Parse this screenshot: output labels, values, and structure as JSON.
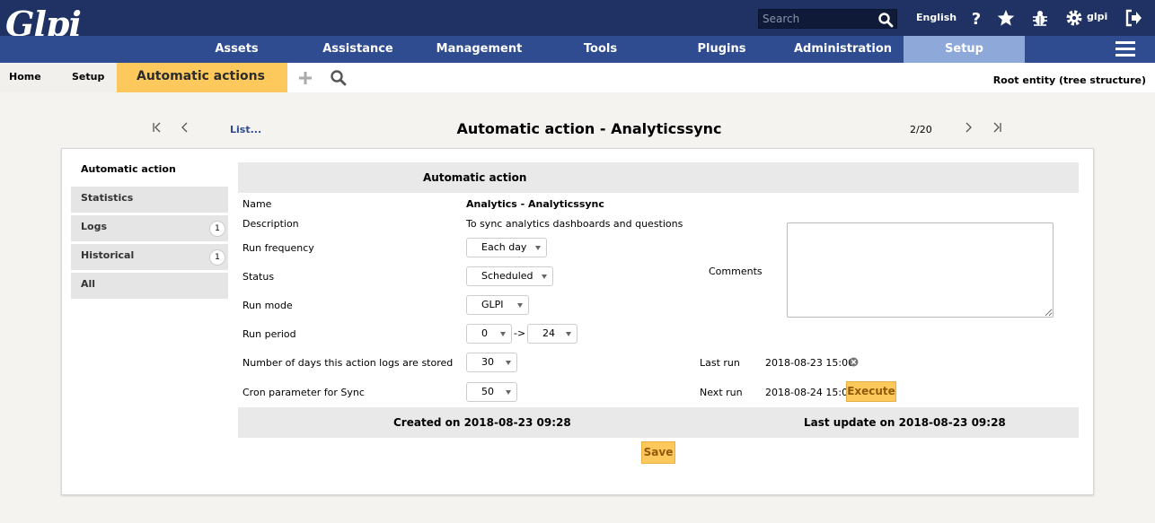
{
  "app": {
    "logo_text": "Glpi"
  },
  "topbar": {
    "search_placeholder": "Search",
    "language": "English",
    "user": "glpi",
    "icons": [
      "search-icon",
      "help-icon",
      "star-icon",
      "bug-icon",
      "gear-icon",
      "logout-icon"
    ]
  },
  "menu": {
    "items": [
      {
        "label": "Assets"
      },
      {
        "label": "Assistance"
      },
      {
        "label": "Management"
      },
      {
        "label": "Tools"
      },
      {
        "label": "Plugins"
      },
      {
        "label": "Administration"
      },
      {
        "label": "Setup",
        "active": true
      }
    ]
  },
  "breadcrumb": {
    "home": "Home",
    "setup": "Setup",
    "current": "Automatic actions",
    "entity": "Root entity (tree structure)"
  },
  "nav": {
    "list_link": "List...",
    "title": "Automatic action - Analyticssync",
    "position": "2/20"
  },
  "tabs": [
    {
      "label": "Automatic action",
      "active": true
    },
    {
      "label": "Statistics"
    },
    {
      "label": "Logs",
      "badge": "1"
    },
    {
      "label": "Historical",
      "badge": "1"
    },
    {
      "label": "All"
    }
  ],
  "form": {
    "header": "Automatic action",
    "name_label": "Name",
    "name_value": "Analytics - Analyticssync",
    "description_label": "Description",
    "description_value": "To sync analytics dashboards and questions",
    "frequency_label": "Run frequency",
    "frequency_value": "Each day",
    "status_label": "Status",
    "status_value": "Scheduled",
    "mode_label": "Run mode",
    "mode_value": "GLPI",
    "period_label": "Run period",
    "period_from": "0",
    "period_arrow": "->",
    "period_to": "24",
    "logs_days_label": "Number of days this action logs are stored",
    "logs_days_value": "30",
    "cron_param_label": "Cron parameter for Sync",
    "cron_param_value": "50",
    "comments_label": "Comments",
    "comments_value": "",
    "last_run_label": "Last run",
    "last_run_value": "2018-08-23 15:00",
    "next_run_label": "Next run",
    "next_run_value": "2018-08-24 15:00",
    "execute_label": "Execute",
    "created": "Created on 2018-08-23 09:28",
    "updated": "Last update on 2018-08-23 09:28",
    "save_label": "Save"
  },
  "colors": {
    "topbar": "#1f3263",
    "menubar": "#2e4c8f",
    "menu_active": "#8ea8d9",
    "accent": "#fec95c"
  }
}
